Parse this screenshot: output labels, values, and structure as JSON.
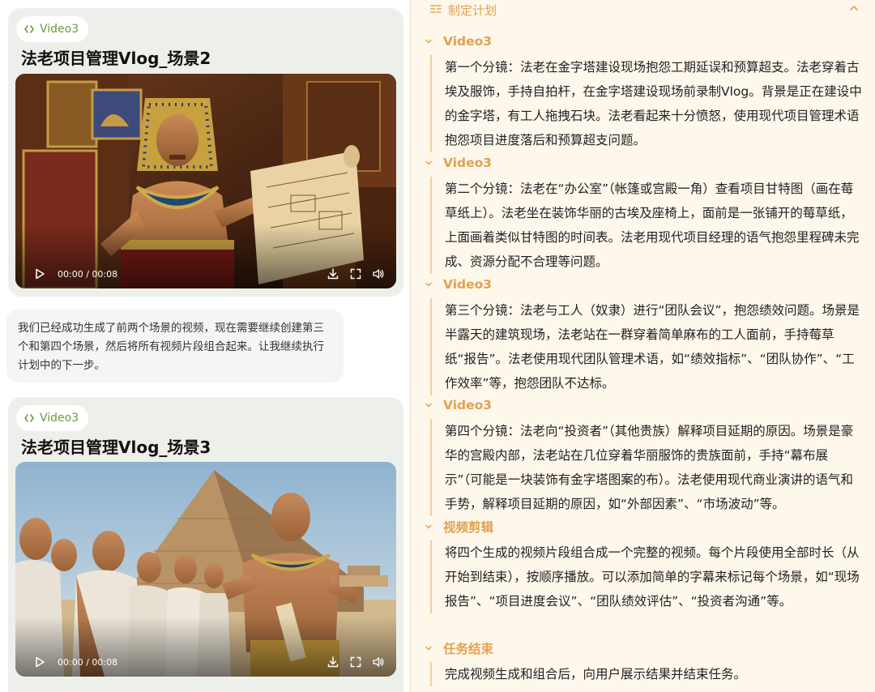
{
  "cards": [
    {
      "tag": "Video3",
      "title": "法老项目管理Vlog_场景2",
      "time": "00:00 / 00:08"
    },
    {
      "tag": "Video3",
      "title": "法老项目管理Vlog_场景3",
      "time": "00:00 / 00:08"
    }
  ],
  "message": "我们已经成功生成了前两个场景的视频，现在需要继续创建第三个和第四个场景，然后将所有视频片段组合起来。让我继续执行计划中的下一步。",
  "plan": {
    "title": "制定计划",
    "sections": [
      {
        "title": "Video3",
        "body": "第一个分镜：法老在金字塔建设现场抱怨工期延误和预算超支。法老穿着古埃及服饰，手持自拍杆，在金字塔建设现场前录制Vlog。背景是正在建设中的金字塔，有工人拖拽石块。法老看起来十分愤怒，使用现代项目管理术语抱怨项目进度落后和预算超支问题。"
      },
      {
        "title": "Video3",
        "body": "第二个分镜：法老在“办公室”（帐篷或宫殿一角）查看项目甘特图（画在莓草纸上）。法老坐在装饰华丽的古埃及座椅上，面前是一张铺开的莓草纸，上面画着类似甘特图的时间表。法老用现代项目经理的语气抱怨里程碑未完成、资源分配不合理等问题。"
      },
      {
        "title": "Video3",
        "body": "第三个分镜：法老与工人（奴隶）进行“团队会议”，抱怨绩效问题。场景是半露天的建筑现场，法老站在一群穿着简单麻布的工人面前，手持莓草纸“报告”。法老使用现代团队管理术语，如“绩效指标”、“团队协作”、“工作效率”等，抱怨团队不达标。"
      },
      {
        "title": "Video3",
        "body": "第四个分镜：法老向“投资者”（其他贵族）解释项目延期的原因。场景是豪华的宫殿内部，法老站在几位穿着华丽服饰的贵族面前，手持“幕布展示”（可能是一块装饰有金字塔图案的布）。法老使用现代商业演讲的语气和手势，解释项目延期的原因，如“外部因素”、“市场波动”等。"
      },
      {
        "title": "视频剪辑",
        "body": "将四个生成的视频片段组合成一个完整的视频。每个片段使用全部时长（从开始到结束），按顺序播放。可以添加简单的字幕来标记每个场景，如“现场报告”、“项目进度会议”、“团队绩效评估”、“投资者沟通”等。"
      },
      {
        "title": "任务结束",
        "body": "完成视频生成和组合后，向用户展示结果并结束任务。"
      }
    ]
  }
}
